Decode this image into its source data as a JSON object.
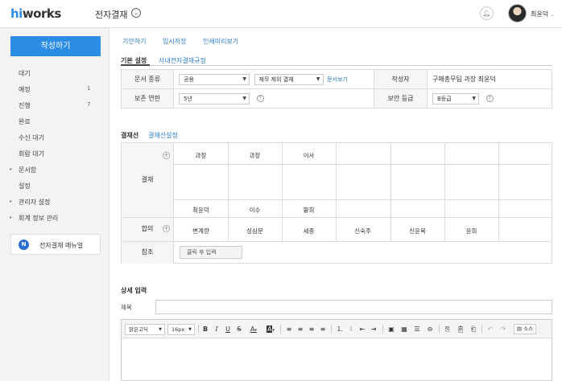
{
  "header": {
    "logo_hi": "hi",
    "logo_rest": "works",
    "app_title": "전자결재",
    "user_name": "최윤덕"
  },
  "sidebar": {
    "compose_label": "작성하기",
    "items": [
      {
        "label": "대기",
        "count": ""
      },
      {
        "label": "예정",
        "count": "1"
      },
      {
        "label": "진행",
        "count": "7"
      },
      {
        "label": "완료",
        "count": ""
      },
      {
        "label": "수신 대기",
        "count": ""
      },
      {
        "label": "회람 대기",
        "count": ""
      },
      {
        "label": "문서함",
        "count": ""
      },
      {
        "label": "설정",
        "count": ""
      },
      {
        "label": "관리자 설정",
        "count": ""
      },
      {
        "label": "회계 정보 관리",
        "count": ""
      }
    ],
    "manual_badge": "N",
    "manual_label": "전자결재 매뉴얼"
  },
  "actions": {
    "draft": "기안하기",
    "temp_save": "임시저장",
    "print_preview": "인쇄미리보기"
  },
  "tabs": {
    "basic": "기본 설정",
    "rules": "사내전자결재규정"
  },
  "info": {
    "doc_type_label": "문서 종류",
    "doc_type_value": "공용",
    "doc_form_value": "재무 제외 결재",
    "view_doc_link": "문서보기",
    "author_label": "작성자",
    "author_value": "구매총무팀 과장 최윤덕",
    "retention_label": "보존 연한",
    "retention_value": "5년",
    "security_label": "보안 등급",
    "security_value": "B등급"
  },
  "approval": {
    "title": "결재선",
    "settings_link": "결재선설정",
    "row_label_approve": "결재",
    "row_label_agree": "합의",
    "row_label_ref": "참조",
    "positions": [
      "과장",
      "과장",
      "이사"
    ],
    "names": [
      "최윤덕",
      "이수",
      "황회"
    ],
    "agree_names": [
      "변계량",
      "성삼문",
      "세종",
      "신숙주",
      "신윤복",
      "윤회"
    ],
    "ref_placeholder": "클릭 후 입력"
  },
  "detail": {
    "title": "상세 입력",
    "subject_label": "제목",
    "font_family": "맑은고딕",
    "font_size": "16px",
    "source_label": "소스"
  }
}
